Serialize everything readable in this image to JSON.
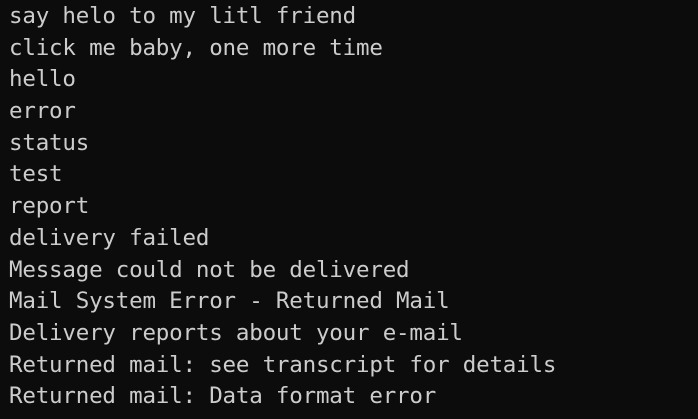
{
  "console": {
    "lines": [
      "say helo to my litl friend",
      "click me baby, one more time",
      "hello",
      "error",
      "status",
      "test",
      "report",
      "delivery failed",
      "Message could not be delivered",
      "Mail System Error - Returned Mail",
      "Delivery reports about your e-mail",
      "Returned mail: see transcript for details",
      "Returned mail: Data format error"
    ]
  }
}
